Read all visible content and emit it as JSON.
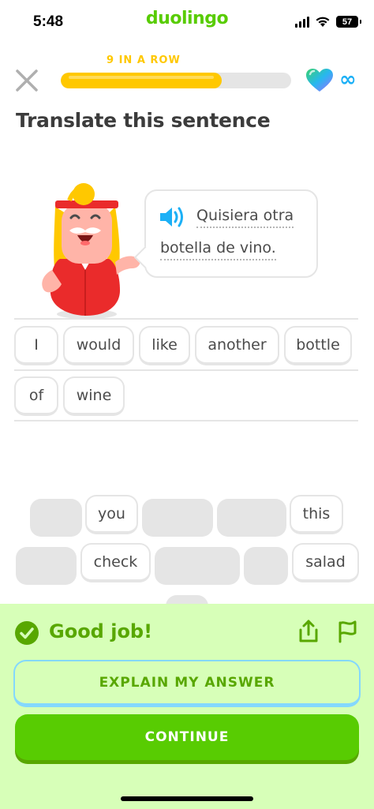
{
  "status_bar": {
    "time": "5:48",
    "brand": "duolingo",
    "battery": "57"
  },
  "header": {
    "streak_label": "9 IN A ROW",
    "progress_fraction": 0.7,
    "hearts": "∞"
  },
  "title": "Translate this sentence",
  "bubble": {
    "line1": "Quisiera otra",
    "line2": "botella de vino."
  },
  "answer_words": [
    "I",
    "would",
    "like",
    "another",
    "bottle",
    "of",
    "wine"
  ],
  "word_bank": [
    "you",
    "this",
    "check",
    "salad"
  ],
  "feedback": {
    "message": "Good job!",
    "explain_label": "EXPLAIN MY ANSWER",
    "continue_label": "CONTINUE"
  },
  "colors": {
    "brand_green": "#58cc02",
    "dark_green": "#58a700",
    "feedback_bg": "#d7ffb8",
    "streak_yellow": "#ffc800",
    "blue": "#1cb0f6"
  }
}
